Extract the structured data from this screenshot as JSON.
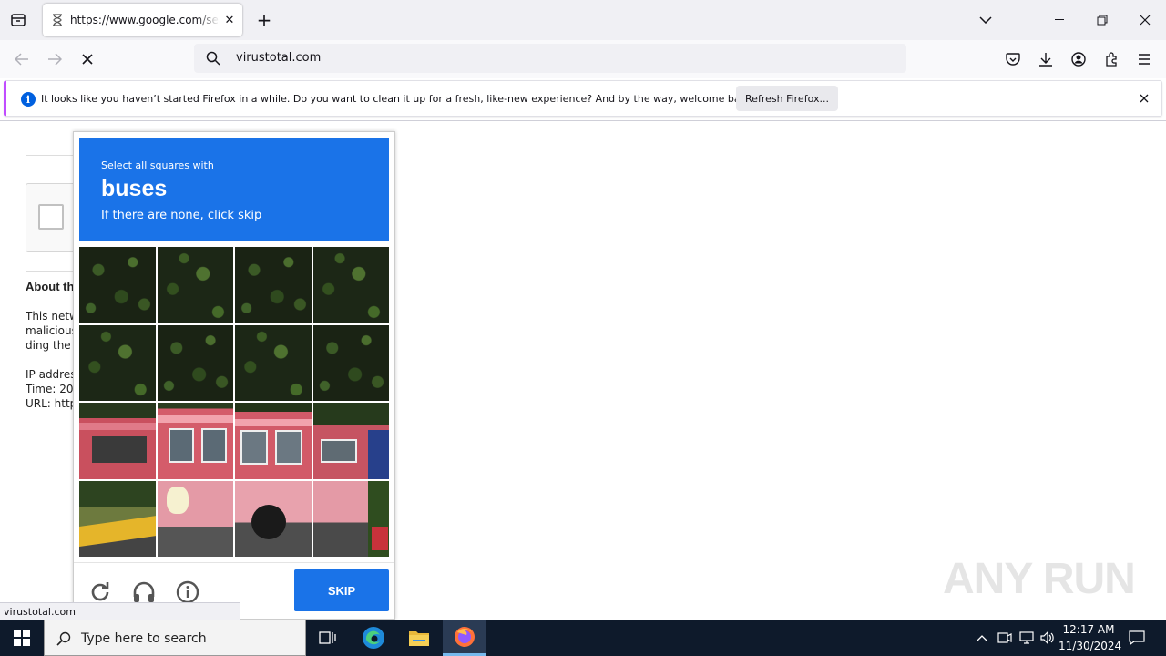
{
  "browser": {
    "tab": {
      "title": "https://www.google.com/search"
    },
    "urlbar": {
      "value": "virustotal.com"
    },
    "notification": {
      "message": "It looks like you haven’t started Firefox in a while. Do you want to clean it up for a fresh, like-new experience? And by the way, welcome back!",
      "button_label": "Refresh Firefox..."
    },
    "status_url": "virustotal.com"
  },
  "page": {
    "heading": "About th",
    "lines": [
      "This netw",
      "malicious",
      "ding the",
      "IP addres",
      "Time: 20",
      "URL: http"
    ]
  },
  "captcha": {
    "instruction": "Select all squares with",
    "target": "buses",
    "hint": "If there are none, click skip",
    "skip_label": "SKIP",
    "icons": [
      "reload-icon",
      "audio-icon",
      "info-icon"
    ]
  },
  "taskbar": {
    "search_placeholder": "Type here to search",
    "time": "12:17 AM",
    "date": "11/30/2024"
  },
  "watermark": "ANY RUN",
  "colors": {
    "captcha_blue": "#1a73e8",
    "notification_accent": "#c04cff",
    "info_blue": "#0060df",
    "taskbar": "#0e1a2b"
  }
}
